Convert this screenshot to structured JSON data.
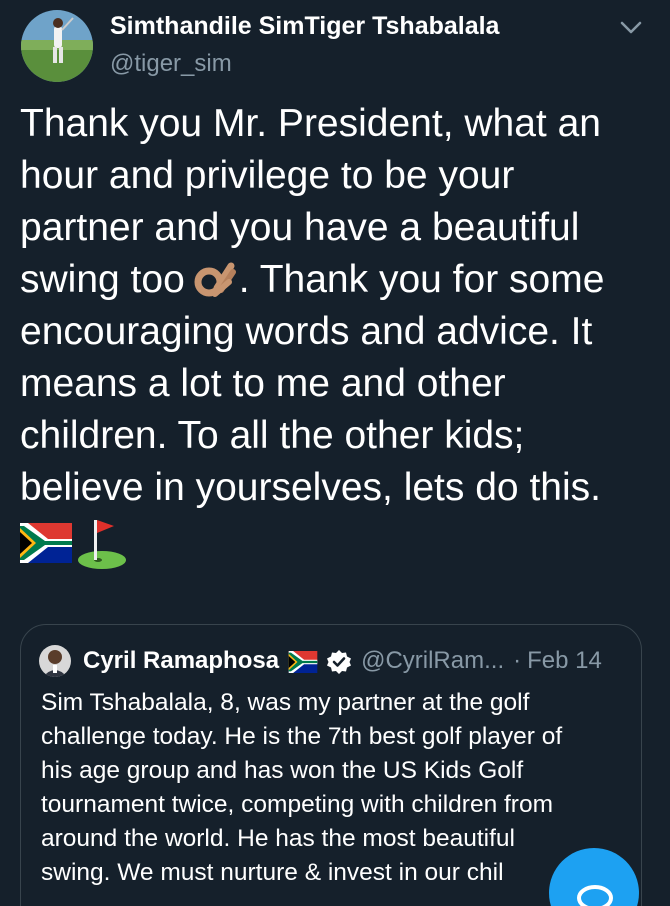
{
  "tweet": {
    "author": {
      "name": "Simthandile SimTiger Tshabalala",
      "handle": "@tiger_sim"
    },
    "text_lines": [
      "Thank you Mr. President, what an",
      "hour and privilege to be your",
      "partner and you have a beautiful",
      "swing too",
      ". Thank you for some",
      "encouraging words and advice. It",
      "means a lot to me and other",
      "children. To all the other kids;",
      "believe in yourselves, lets do this."
    ],
    "emoji_icons": [
      "ok-hand-emoji",
      "south-africa-flag-emoji",
      "golf-flag-emoji"
    ]
  },
  "quoted_tweet": {
    "author": {
      "name": "Cyril Ramaphosa",
      "handle": "@CyrilRam...",
      "verified": true
    },
    "separator": "·",
    "date": "Feb 14",
    "text_lines": [
      "Sim Tshabalala, 8, was my partner at the golf",
      "challenge today. He is the 7th best golf player of",
      "his age group and has won the US Kids Golf",
      "tournament twice, competing with children from",
      "around the world. He has the most beautiful",
      "swing. We must nurture & invest in our chil"
    ]
  },
  "colors": {
    "background": "#15202b",
    "text_primary": "#ffffff",
    "text_secondary": "#8899a6",
    "border": "#38444d",
    "accent": "#1da1f2"
  },
  "fab": {
    "icon": "compose-icon"
  }
}
